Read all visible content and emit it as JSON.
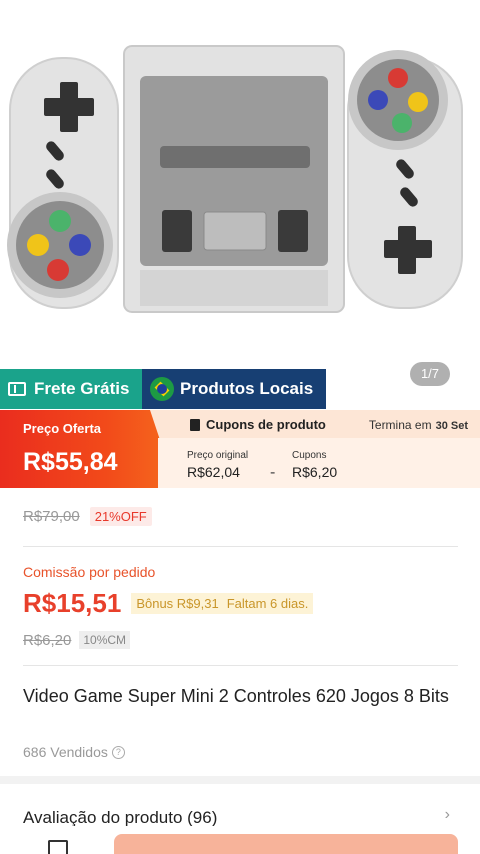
{
  "gallery": {
    "counter": "1/7"
  },
  "badges": {
    "free_shipping": "Frete Grátis",
    "local_products": "Produtos Locais"
  },
  "offer": {
    "label": "Preço Oferta",
    "price": "R$55,84",
    "coupons_title": "Cupons de produto",
    "ends_label": "Termina em",
    "ends_date": "30 Set",
    "original_label": "Preço original",
    "original_value": "R$62,04",
    "minus": "-",
    "coupons_label": "Cupons",
    "coupons_value": "R$6,20"
  },
  "pricing": {
    "list_price": "R$79,00",
    "discount": "21%OFF"
  },
  "commission": {
    "label": "Comissão por pedido",
    "value": "R$15,51",
    "bonus": "Bônus R$9,31",
    "days_left": "Faltam 6 dias.",
    "old_value": "R$6,20",
    "rate": "10%CM"
  },
  "product": {
    "title": "Video Game Super Mini 2 Controles 620 Jogos 8 Bits",
    "sold": "686 Vendidos",
    "help_glyph": "?"
  },
  "review": {
    "label": "Avaliação do produto (96)",
    "arrow": "›"
  },
  "colors": {
    "offer_red": "#ea2d1e",
    "commission_orange": "#e8402b",
    "free_shipping_teal": "#1aa38b",
    "local_navy": "#173f73",
    "cta_peach": "#f7b39a"
  }
}
